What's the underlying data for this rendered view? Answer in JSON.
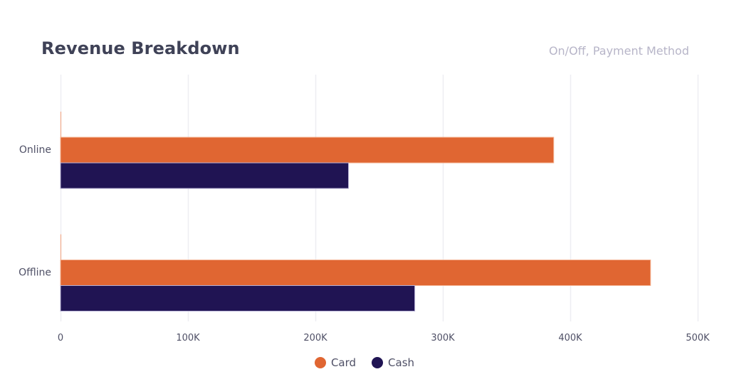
{
  "chart_data": {
    "type": "bar",
    "orientation": "horizontal",
    "title": "Revenue Breakdown",
    "subtitle": "On/Off, Payment Method",
    "categories": [
      "Online",
      "Offline"
    ],
    "series": [
      {
        "name": "Card",
        "color": "#e06632",
        "values": [
          387000,
          463000
        ]
      },
      {
        "name": "Cash",
        "color": "#201453",
        "values": [
          226000,
          278000
        ]
      }
    ],
    "xlabel": "",
    "ylabel": "",
    "xlim": [
      0,
      500000
    ],
    "x_ticks": [
      0,
      100000,
      200000,
      300000,
      400000,
      500000
    ],
    "x_tick_labels": [
      "0",
      "100K",
      "200K",
      "300K",
      "400K",
      "500K"
    ],
    "grid": true,
    "legend_position": "bottom-center"
  },
  "colors": {
    "title": "#3f4257",
    "subtitle": "#b7b5c8",
    "grid": "#eeeef2",
    "zero_marker": "#f2a27e"
  }
}
